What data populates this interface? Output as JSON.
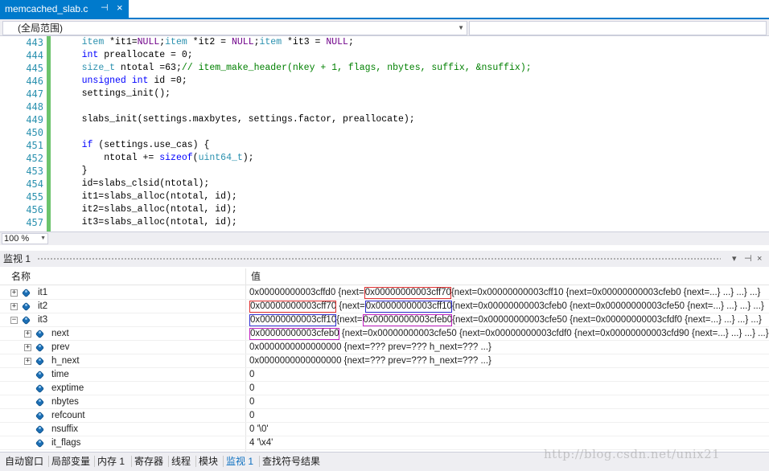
{
  "tab": {
    "title": "memcached_slab.c",
    "pin_glyph": "⊣",
    "close_glyph": "×"
  },
  "scope": {
    "label": "(全局范围)"
  },
  "editor": {
    "lines": [
      {
        "num": "443",
        "tokens": [
          [
            "t",
            "    "
          ],
          [
            "ty",
            "item"
          ],
          [
            "t",
            " *it1="
          ],
          [
            "m",
            "NULL"
          ],
          [
            "t",
            ";"
          ],
          [
            "ty",
            "item"
          ],
          [
            "t",
            " *it2 = "
          ],
          [
            "m",
            "NULL"
          ],
          [
            "t",
            ";"
          ],
          [
            "ty",
            "item"
          ],
          [
            "t",
            " *it3 = "
          ],
          [
            "m",
            "NULL"
          ],
          [
            "t",
            ";"
          ]
        ]
      },
      {
        "num": "444",
        "tokens": [
          [
            "t",
            "    "
          ],
          [
            "k",
            "int"
          ],
          [
            "t",
            " preallocate = 0;"
          ]
        ]
      },
      {
        "num": "445",
        "tokens": [
          [
            "t",
            "    "
          ],
          [
            "ty",
            "size_t"
          ],
          [
            "t",
            " ntotal =63;"
          ],
          [
            "c",
            "// item_make_header(nkey + 1, flags, nbytes, suffix, &nsuffix);"
          ]
        ]
      },
      {
        "num": "446",
        "tokens": [
          [
            "t",
            "    "
          ],
          [
            "k",
            "unsigned"
          ],
          [
            "t",
            " "
          ],
          [
            "k",
            "int"
          ],
          [
            "t",
            " id =0;"
          ]
        ]
      },
      {
        "num": "447",
        "tokens": [
          [
            "t",
            "    settings_init();"
          ]
        ]
      },
      {
        "num": "448",
        "tokens": []
      },
      {
        "num": "449",
        "tokens": [
          [
            "t",
            "    slabs_init(settings.maxbytes, settings.factor, preallocate);"
          ]
        ]
      },
      {
        "num": "450",
        "tokens": []
      },
      {
        "num": "451",
        "tokens": [
          [
            "t",
            "    "
          ],
          [
            "k",
            "if"
          ],
          [
            "t",
            " (settings.use_cas) {"
          ]
        ]
      },
      {
        "num": "452",
        "tokens": [
          [
            "t",
            "        ntotal += "
          ],
          [
            "k",
            "sizeof"
          ],
          [
            "t",
            "("
          ],
          [
            "ty",
            "uint64_t"
          ],
          [
            "t",
            ");"
          ]
        ]
      },
      {
        "num": "453",
        "tokens": [
          [
            "t",
            "    }"
          ]
        ]
      },
      {
        "num": "454",
        "tokens": [
          [
            "t",
            "    id=slabs_clsid(ntotal);"
          ]
        ]
      },
      {
        "num": "455",
        "tokens": [
          [
            "t",
            "    it1=slabs_alloc(ntotal, id);"
          ]
        ]
      },
      {
        "num": "456",
        "tokens": [
          [
            "t",
            "    it2=slabs_alloc(ntotal, id);"
          ]
        ]
      },
      {
        "num": "457",
        "tokens": [
          [
            "t",
            "    it3=slabs_alloc(ntotal, id);"
          ]
        ]
      }
    ]
  },
  "zoom": {
    "value": "100 %"
  },
  "watch": {
    "title": "监视 1",
    "col_name": "名称",
    "col_value": "值",
    "rows": [
      {
        "name": "it1",
        "expander": "closed",
        "indent": 0,
        "value": [
          [
            "",
            "0x00000000003cffd0 {next="
          ],
          [
            "red",
            "0x00000000003cff70"
          ],
          [
            "",
            "{next=0x00000000003cff10 {next=0x00000000003cfeb0 {next=...} ...} ...} ...}"
          ]
        ]
      },
      {
        "name": "it2",
        "expander": "closed",
        "indent": 0,
        "value": [
          [
            "red",
            "0x00000000003cff70"
          ],
          [
            "",
            " {next="
          ],
          [
            "blue",
            "0x00000000003cff10"
          ],
          [
            "",
            "{next=0x00000000003cfeb0 {next=0x00000000003cfe50 {next=...} ...} ...} ...}"
          ]
        ]
      },
      {
        "name": "it3",
        "expander": "open",
        "indent": 0,
        "value": [
          [
            "blue",
            "0x00000000003cff10"
          ],
          [
            "",
            "{next="
          ],
          [
            "purple",
            "0x00000000003cfeb0"
          ],
          [
            "",
            "{next=0x00000000003cfe50 {next=0x00000000003cfdf0 {next=...} ...} ...} ...}"
          ]
        ]
      },
      {
        "name": "next",
        "expander": "closed",
        "indent": 1,
        "value": [
          [
            "purple",
            "0x00000000003cfeb0"
          ],
          [
            "",
            " {next=0x00000000003cfe50 {next=0x00000000003cfdf0 {next=0x00000000003cfd90 {next=...} ...} ...} ...}"
          ]
        ]
      },
      {
        "name": "prev",
        "expander": "closed",
        "indent": 1,
        "value": [
          [
            "",
            "0x0000000000000000 {next=??? prev=??? h_next=??? ...}"
          ]
        ]
      },
      {
        "name": "h_next",
        "expander": "closed",
        "indent": 1,
        "value": [
          [
            "",
            "0x0000000000000000 {next=??? prev=??? h_next=??? ...}"
          ]
        ]
      },
      {
        "name": "time",
        "expander": "none",
        "indent": 1,
        "value": [
          [
            "",
            "0"
          ]
        ]
      },
      {
        "name": "exptime",
        "expander": "none",
        "indent": 1,
        "value": [
          [
            "",
            "0"
          ]
        ]
      },
      {
        "name": "nbytes",
        "expander": "none",
        "indent": 1,
        "value": [
          [
            "",
            "0"
          ]
        ]
      },
      {
        "name": "refcount",
        "expander": "none",
        "indent": 1,
        "value": [
          [
            "",
            "0"
          ]
        ]
      },
      {
        "name": "nsuffix",
        "expander": "none",
        "indent": 1,
        "value": [
          [
            "",
            "0 '\\0'"
          ]
        ]
      },
      {
        "name": "it_flags",
        "expander": "none",
        "indent": 1,
        "value": [
          [
            "",
            "4 '\\x4'"
          ]
        ]
      }
    ]
  },
  "bottom_tabs": [
    {
      "label": "自动窗口",
      "active": false
    },
    {
      "label": "局部变量",
      "active": false
    },
    {
      "label": "内存 1",
      "active": false
    },
    {
      "label": "寄存器",
      "active": false
    },
    {
      "label": "线程",
      "active": false
    },
    {
      "label": "模块",
      "active": false
    },
    {
      "label": "监视 1",
      "active": true
    },
    {
      "label": "查找符号结果",
      "active": false
    }
  ],
  "watermark": "http://blog.csdn.net/unix21",
  "colors": {
    "accent": "#007acc",
    "red_box": "#e03030",
    "blue_box": "#3030d0",
    "purple_box": "#c020c0"
  }
}
